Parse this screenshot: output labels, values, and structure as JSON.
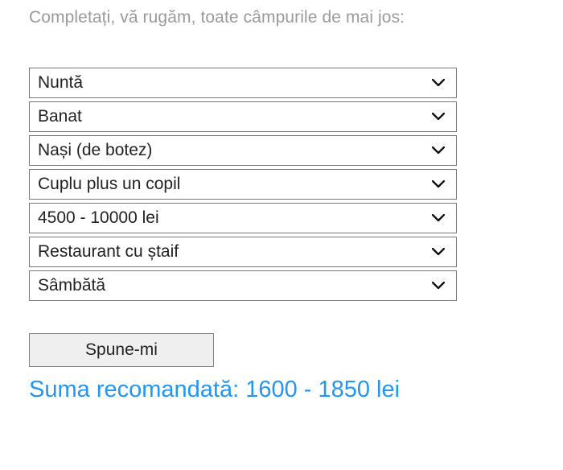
{
  "intro": "Completați, vă rugăm, toate câmpurile de mai jos:",
  "selects": [
    {
      "label": "Nuntă"
    },
    {
      "label": "Banat"
    },
    {
      "label": "Nași (de botez)"
    },
    {
      "label": "Cuplu plus un copil"
    },
    {
      "label": "4500 - 10000 lei"
    },
    {
      "label": "Restaurant cu ștaif"
    },
    {
      "label": "Sâmbătă"
    }
  ],
  "submit_label": "Spune-mi",
  "result_text": "Suma recomandată: 1600 - 1850 lei"
}
